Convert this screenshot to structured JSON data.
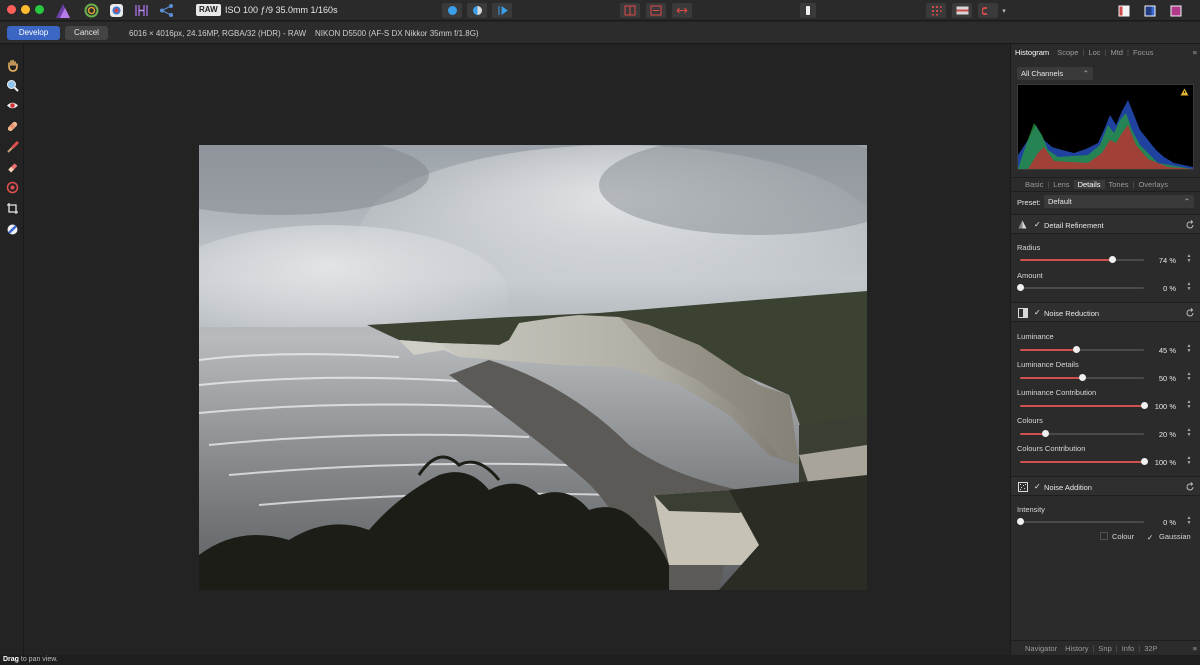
{
  "toolbar": {
    "raw_badge": "RAW",
    "exif": "ISO 100 ƒ/9 35.0mm 1/160s"
  },
  "context_bar": {
    "develop_label": "Develop",
    "cancel_label": "Cancel",
    "image_info": "6016 × 4016px, 24.16MP, RGBA/32 (HDR) - RAW",
    "camera_info": "NIKON D5500 (AF-S DX Nikkor 35mm f/1.8G)"
  },
  "panel": {
    "top_tabs": [
      "Histogram",
      "Scope",
      "Loc",
      "Mtd",
      "Focus"
    ],
    "channel_select": "All Channels",
    "persona_tabs": [
      "Basic",
      "Lens",
      "Details",
      "Tones",
      "Overlays"
    ],
    "preset_label": "Preset:",
    "preset_value": "Default",
    "detail_refinement": {
      "title": "Detail Refinement",
      "sliders": [
        {
          "label": "Radius",
          "value": "74 %",
          "fraction": 0.74
        },
        {
          "label": "Amount",
          "value": "0 %",
          "fraction": 0.0
        }
      ]
    },
    "noise_reduction": {
      "title": "Noise Reduction",
      "sliders": [
        {
          "label": "Luminance",
          "value": "45 %",
          "fraction": 0.45
        },
        {
          "label": "Luminance Details",
          "value": "50 %",
          "fraction": 0.5
        },
        {
          "label": "Luminance Contribution",
          "value": "100 %",
          "fraction": 1.0
        },
        {
          "label": "Colours",
          "value": "20 %",
          "fraction": 0.2
        },
        {
          "label": "Colours Contribution",
          "value": "100 %",
          "fraction": 1.0
        }
      ]
    },
    "noise_addition": {
      "title": "Noise Addition",
      "sliders": [
        {
          "label": "Intensity",
          "value": "0 %",
          "fraction": 0.0
        }
      ],
      "colour_label": "Colour",
      "gaussian_label": "Gaussian"
    },
    "bottom_tabs": [
      "Navigator",
      "History",
      "Snp",
      "Info",
      "32P"
    ]
  },
  "status": {
    "bold": "Drag",
    "text": " to pan view."
  },
  "colors": {
    "accent": "#3b66c4",
    "slider_fill": "#d0504f",
    "panel_bg": "#2b2b2b",
    "canvas_bg": "#232323"
  }
}
